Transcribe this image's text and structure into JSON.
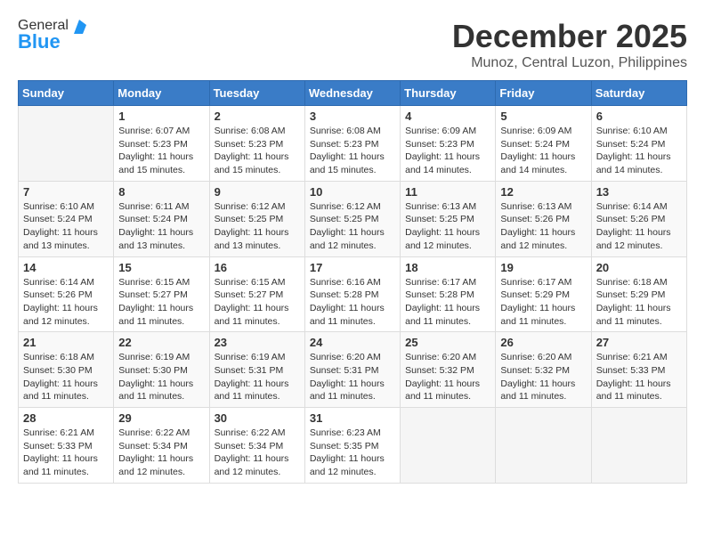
{
  "logo": {
    "general": "General",
    "blue": "Blue"
  },
  "header": {
    "month": "December 2025",
    "location": "Munoz, Central Luzon, Philippines"
  },
  "weekdays": [
    "Sunday",
    "Monday",
    "Tuesday",
    "Wednesday",
    "Thursday",
    "Friday",
    "Saturday"
  ],
  "weeks": [
    [
      {
        "day": "",
        "sunrise": "",
        "sunset": "",
        "daylight": ""
      },
      {
        "day": "1",
        "sunrise": "Sunrise: 6:07 AM",
        "sunset": "Sunset: 5:23 PM",
        "daylight": "Daylight: 11 hours and 15 minutes."
      },
      {
        "day": "2",
        "sunrise": "Sunrise: 6:08 AM",
        "sunset": "Sunset: 5:23 PM",
        "daylight": "Daylight: 11 hours and 15 minutes."
      },
      {
        "day": "3",
        "sunrise": "Sunrise: 6:08 AM",
        "sunset": "Sunset: 5:23 PM",
        "daylight": "Daylight: 11 hours and 15 minutes."
      },
      {
        "day": "4",
        "sunrise": "Sunrise: 6:09 AM",
        "sunset": "Sunset: 5:23 PM",
        "daylight": "Daylight: 11 hours and 14 minutes."
      },
      {
        "day": "5",
        "sunrise": "Sunrise: 6:09 AM",
        "sunset": "Sunset: 5:24 PM",
        "daylight": "Daylight: 11 hours and 14 minutes."
      },
      {
        "day": "6",
        "sunrise": "Sunrise: 6:10 AM",
        "sunset": "Sunset: 5:24 PM",
        "daylight": "Daylight: 11 hours and 14 minutes."
      }
    ],
    [
      {
        "day": "7",
        "sunrise": "Sunrise: 6:10 AM",
        "sunset": "Sunset: 5:24 PM",
        "daylight": "Daylight: 11 hours and 13 minutes."
      },
      {
        "day": "8",
        "sunrise": "Sunrise: 6:11 AM",
        "sunset": "Sunset: 5:24 PM",
        "daylight": "Daylight: 11 hours and 13 minutes."
      },
      {
        "day": "9",
        "sunrise": "Sunrise: 6:12 AM",
        "sunset": "Sunset: 5:25 PM",
        "daylight": "Daylight: 11 hours and 13 minutes."
      },
      {
        "day": "10",
        "sunrise": "Sunrise: 6:12 AM",
        "sunset": "Sunset: 5:25 PM",
        "daylight": "Daylight: 11 hours and 12 minutes."
      },
      {
        "day": "11",
        "sunrise": "Sunrise: 6:13 AM",
        "sunset": "Sunset: 5:25 PM",
        "daylight": "Daylight: 11 hours and 12 minutes."
      },
      {
        "day": "12",
        "sunrise": "Sunrise: 6:13 AM",
        "sunset": "Sunset: 5:26 PM",
        "daylight": "Daylight: 11 hours and 12 minutes."
      },
      {
        "day": "13",
        "sunrise": "Sunrise: 6:14 AM",
        "sunset": "Sunset: 5:26 PM",
        "daylight": "Daylight: 11 hours and 12 minutes."
      }
    ],
    [
      {
        "day": "14",
        "sunrise": "Sunrise: 6:14 AM",
        "sunset": "Sunset: 5:26 PM",
        "daylight": "Daylight: 11 hours and 12 minutes."
      },
      {
        "day": "15",
        "sunrise": "Sunrise: 6:15 AM",
        "sunset": "Sunset: 5:27 PM",
        "daylight": "Daylight: 11 hours and 11 minutes."
      },
      {
        "day": "16",
        "sunrise": "Sunrise: 6:15 AM",
        "sunset": "Sunset: 5:27 PM",
        "daylight": "Daylight: 11 hours and 11 minutes."
      },
      {
        "day": "17",
        "sunrise": "Sunrise: 6:16 AM",
        "sunset": "Sunset: 5:28 PM",
        "daylight": "Daylight: 11 hours and 11 minutes."
      },
      {
        "day": "18",
        "sunrise": "Sunrise: 6:17 AM",
        "sunset": "Sunset: 5:28 PM",
        "daylight": "Daylight: 11 hours and 11 minutes."
      },
      {
        "day": "19",
        "sunrise": "Sunrise: 6:17 AM",
        "sunset": "Sunset: 5:29 PM",
        "daylight": "Daylight: 11 hours and 11 minutes."
      },
      {
        "day": "20",
        "sunrise": "Sunrise: 6:18 AM",
        "sunset": "Sunset: 5:29 PM",
        "daylight": "Daylight: 11 hours and 11 minutes."
      }
    ],
    [
      {
        "day": "21",
        "sunrise": "Sunrise: 6:18 AM",
        "sunset": "Sunset: 5:30 PM",
        "daylight": "Daylight: 11 hours and 11 minutes."
      },
      {
        "day": "22",
        "sunrise": "Sunrise: 6:19 AM",
        "sunset": "Sunset: 5:30 PM",
        "daylight": "Daylight: 11 hours and 11 minutes."
      },
      {
        "day": "23",
        "sunrise": "Sunrise: 6:19 AM",
        "sunset": "Sunset: 5:31 PM",
        "daylight": "Daylight: 11 hours and 11 minutes."
      },
      {
        "day": "24",
        "sunrise": "Sunrise: 6:20 AM",
        "sunset": "Sunset: 5:31 PM",
        "daylight": "Daylight: 11 hours and 11 minutes."
      },
      {
        "day": "25",
        "sunrise": "Sunrise: 6:20 AM",
        "sunset": "Sunset: 5:32 PM",
        "daylight": "Daylight: 11 hours and 11 minutes."
      },
      {
        "day": "26",
        "sunrise": "Sunrise: 6:20 AM",
        "sunset": "Sunset: 5:32 PM",
        "daylight": "Daylight: 11 hours and 11 minutes."
      },
      {
        "day": "27",
        "sunrise": "Sunrise: 6:21 AM",
        "sunset": "Sunset: 5:33 PM",
        "daylight": "Daylight: 11 hours and 11 minutes."
      }
    ],
    [
      {
        "day": "28",
        "sunrise": "Sunrise: 6:21 AM",
        "sunset": "Sunset: 5:33 PM",
        "daylight": "Daylight: 11 hours and 11 minutes."
      },
      {
        "day": "29",
        "sunrise": "Sunrise: 6:22 AM",
        "sunset": "Sunset: 5:34 PM",
        "daylight": "Daylight: 11 hours and 12 minutes."
      },
      {
        "day": "30",
        "sunrise": "Sunrise: 6:22 AM",
        "sunset": "Sunset: 5:34 PM",
        "daylight": "Daylight: 11 hours and 12 minutes."
      },
      {
        "day": "31",
        "sunrise": "Sunrise: 6:23 AM",
        "sunset": "Sunset: 5:35 PM",
        "daylight": "Daylight: 11 hours and 12 minutes."
      },
      {
        "day": "",
        "sunrise": "",
        "sunset": "",
        "daylight": ""
      },
      {
        "day": "",
        "sunrise": "",
        "sunset": "",
        "daylight": ""
      },
      {
        "day": "",
        "sunrise": "",
        "sunset": "",
        "daylight": ""
      }
    ]
  ]
}
